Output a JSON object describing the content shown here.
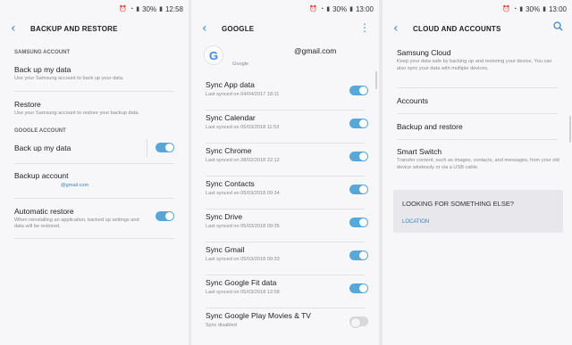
{
  "status": {
    "battery": "30%",
    "time_p1": "12:58",
    "time_p2": "13:00",
    "time_p3": "13:00",
    "icons": [
      "alarm-icon",
      "wifi-icon",
      "signal-icon",
      "battery-icon"
    ]
  },
  "backup_restore": {
    "title": "BACKUP AND RESTORE",
    "samsung_header": "SAMSUNG ACCOUNT",
    "backup_title": "Back up my data",
    "backup_desc": "Use your Samsung account to back up your data.",
    "restore_title": "Restore",
    "restore_desc": "Use your Samsung account to restore your backup data.",
    "google_header": "GOOGLE ACCOUNT",
    "google_backup_title": "Back up my data",
    "google_backup_on": true,
    "backup_account_title": "Backup account",
    "backup_account_value": "@gmail.com",
    "auto_restore_title": "Automatic restore",
    "auto_restore_desc": "When reinstalling an application, backed up settings and data will be restored.",
    "auto_restore_on": true
  },
  "google": {
    "title": "GOOGLE",
    "account_email": "@gmail.com",
    "account_label": "Google",
    "logo_letter": "G",
    "sync_items": [
      {
        "title": "Sync App data",
        "sub": "Last synced on 04/04/2017  18:11",
        "on": true
      },
      {
        "title": "Sync Calendar",
        "sub": "Last synced on 05/03/2018  11:53",
        "on": true
      },
      {
        "title": "Sync Chrome",
        "sub": "Last synced on 28/02/2018  22:12",
        "on": true
      },
      {
        "title": "Sync Contacts",
        "sub": "Last synced on 05/03/2018  09:34",
        "on": true
      },
      {
        "title": "Sync Drive",
        "sub": "Last synced on 05/03/2018  09:35",
        "on": true
      },
      {
        "title": "Sync Gmail",
        "sub": "Last synced on 05/03/2018  09:33",
        "on": true
      },
      {
        "title": "Sync Google Fit data",
        "sub": "Last synced on 05/03/2018  12:58",
        "on": true
      },
      {
        "title": "Sync Google Play Movies & TV",
        "sub": "Sync disabled",
        "on": false
      }
    ]
  },
  "cloud_accounts": {
    "title": "CLOUD AND ACCOUNTS",
    "samsung_cloud_title": "Samsung Cloud",
    "samsung_cloud_desc": "Keep your data safe by backing up and restoring your device. You can also sync your data with multiple devices.",
    "accounts_title": "Accounts",
    "backup_restore_title": "Backup and restore",
    "smart_switch_title": "Smart Switch",
    "smart_switch_desc": "Transfer content, such as images, contacts, and messages, from your old device wirelessly or via a USB cable.",
    "look_header": "LOOKING FOR SOMETHING ELSE?",
    "look_link": "LOCATION"
  },
  "colors": {
    "accent": "#3e88c8",
    "toggle_on": "#58a7d8",
    "background": "#f7f7f9"
  }
}
